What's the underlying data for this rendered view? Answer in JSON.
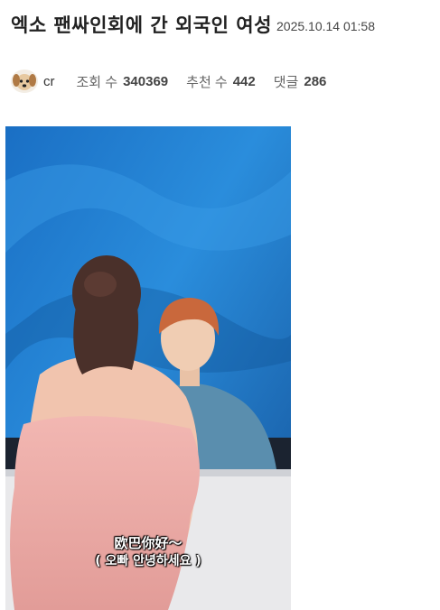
{
  "post": {
    "title": "엑소 팬싸인회에 간 외국인 여성",
    "date": "2025.10.14 01:58",
    "author": "cr",
    "views_label": "조회 수",
    "views": "340369",
    "likes_label": "추천 수",
    "likes": "442",
    "comments_label": "댓글",
    "comments": "286"
  },
  "media": {
    "subtitle_line1": "欧巴你好～",
    "subtitle_line2": "( 오빠 안녕하세요 )"
  },
  "colors": {
    "backdrop": "#1f7fd0",
    "dress": "#e8a9a6",
    "shirt": "#5a8eae",
    "hair_man": "#c9683c"
  },
  "icons": {
    "avatar": "puppy-avatar-icon"
  }
}
